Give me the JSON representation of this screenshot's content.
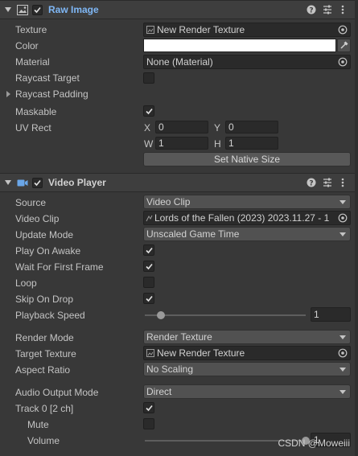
{
  "raw_image": {
    "title": "Raw Image",
    "texture_label": "Texture",
    "texture_value": "New Render Texture",
    "color_label": "Color",
    "color_value": "#ffffff",
    "material_label": "Material",
    "material_value": "None (Material)",
    "raycast_target_label": "Raycast Target",
    "raycast_padding_label": "Raycast Padding",
    "maskable_label": "Maskable",
    "uv_rect_label": "UV Rect",
    "uv_x_label": "X",
    "uv_x_value": "0",
    "uv_y_label": "Y",
    "uv_y_value": "0",
    "uv_w_label": "W",
    "uv_w_value": "1",
    "uv_h_label": "H",
    "uv_h_value": "1",
    "set_native_size_label": "Set Native Size"
  },
  "video_player": {
    "title": "Video Player",
    "source_label": "Source",
    "source_value": "Video Clip",
    "video_clip_label": "Video Clip",
    "video_clip_value": "Lords of the Fallen (2023) 2023.11.27 - 1",
    "update_mode_label": "Update Mode",
    "update_mode_value": "Unscaled Game Time",
    "play_on_awake_label": "Play On Awake",
    "wait_first_frame_label": "Wait For First Frame",
    "loop_label": "Loop",
    "skip_on_drop_label": "Skip On Drop",
    "playback_speed_label": "Playback Speed",
    "playback_speed_value": "1",
    "playback_speed_fraction": 0.1,
    "render_mode_label": "Render Mode",
    "render_mode_value": "Render Texture",
    "target_texture_label": "Target Texture",
    "target_texture_value": "New Render Texture",
    "aspect_ratio_label": "Aspect Ratio",
    "aspect_ratio_value": "No Scaling",
    "audio_output_label": "Audio Output Mode",
    "audio_output_value": "Direct",
    "track_label": "Track 0 [2 ch]",
    "mute_label": "Mute",
    "volume_label": "Volume",
    "volume_value": "1",
    "volume_fraction": 1.0
  },
  "watermark": "CSDN @Moweiii",
  "colors": {
    "accent": "#7fb7f5",
    "panel_bg": "#383838",
    "field_bg": "#2a2a2a"
  }
}
